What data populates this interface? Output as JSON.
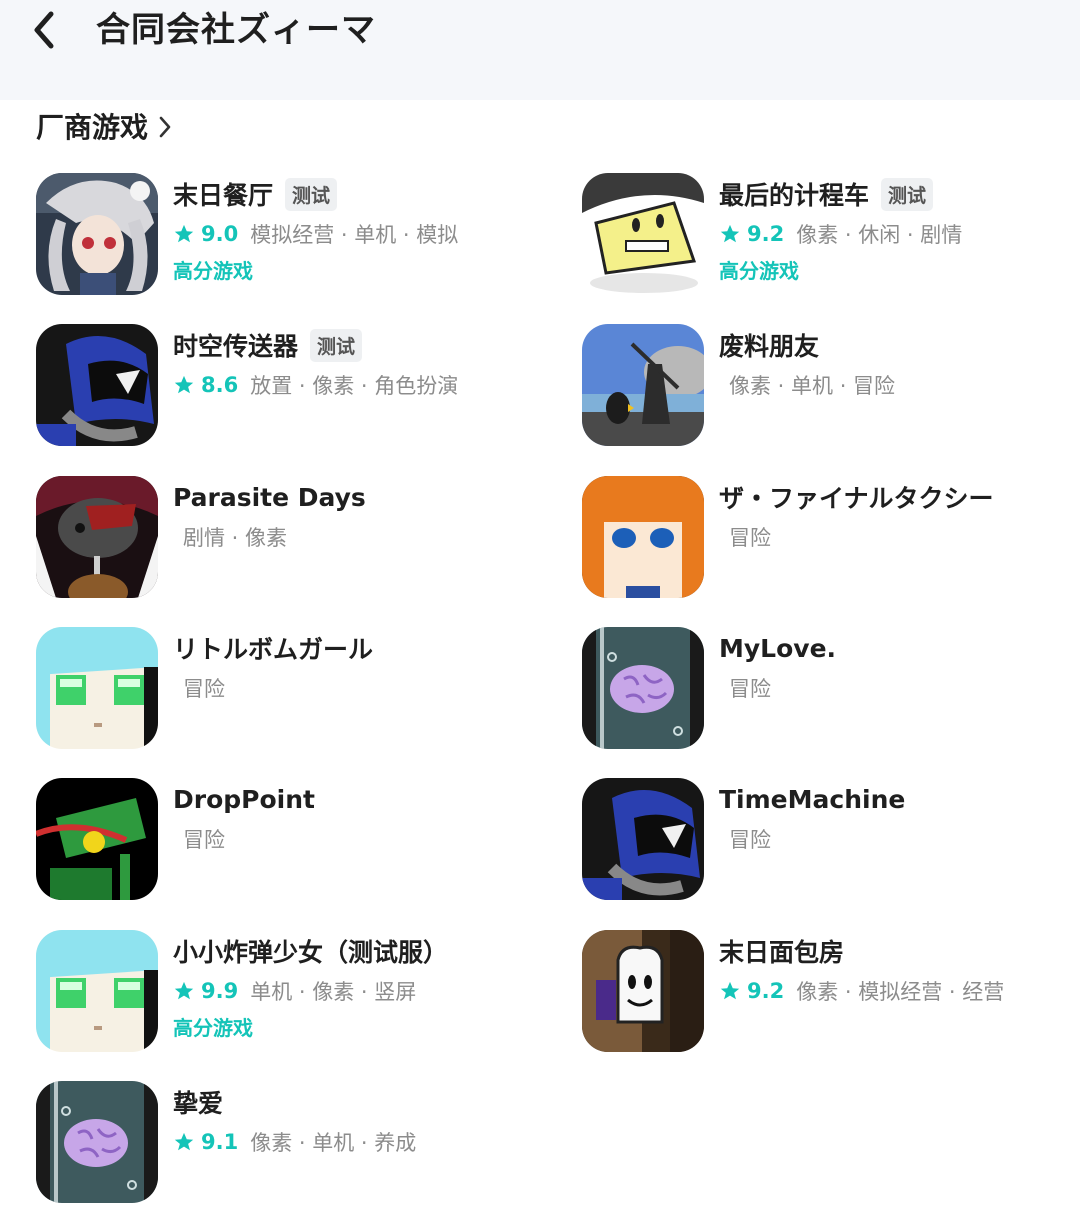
{
  "header": {
    "title": "合同会社ズィーマ"
  },
  "section": {
    "title": "厂商游戏"
  },
  "colors": {
    "accent": "#14c4b8",
    "muted": "#8c8c8c",
    "header_bg": "#f5f7fa"
  },
  "games": [
    {
      "title": "末日餐厅",
      "tag": "测试",
      "score": "9.0",
      "categories": "模拟经营 · 单机 · 模拟",
      "badge": "高分游戏"
    },
    {
      "title": "最后的计程车",
      "tag": "测试",
      "score": "9.2",
      "categories": "像素 · 休闲 · 剧情",
      "badge": "高分游戏"
    },
    {
      "title": "时空传送器",
      "tag": "测试",
      "score": "8.6",
      "categories": "放置 · 像素 · 角色扮演"
    },
    {
      "title": "废料朋友",
      "categories": "像素 · 单机 · 冒险"
    },
    {
      "title": "Parasite Days",
      "categories": "剧情 · 像素"
    },
    {
      "title": "ザ・ファイナルタクシー",
      "categories": "冒险"
    },
    {
      "title": "リトルボムガール",
      "categories": "冒险"
    },
    {
      "title": "MyLove.",
      "categories": "冒险"
    },
    {
      "title": "DropPoint",
      "categories": "冒险"
    },
    {
      "title": "TimeMachine",
      "categories": "冒险"
    },
    {
      "title": "小小炸弹少女（测试服）",
      "score": "9.9",
      "categories": "单机 · 像素 · 竖屏",
      "badge": "高分游戏"
    },
    {
      "title": "末日面包房",
      "score": "9.2",
      "categories": "像素 · 模拟经营 · 经营"
    },
    {
      "title": "挚爱",
      "score": "9.1",
      "categories": "像素 · 单机 · 养成"
    }
  ]
}
